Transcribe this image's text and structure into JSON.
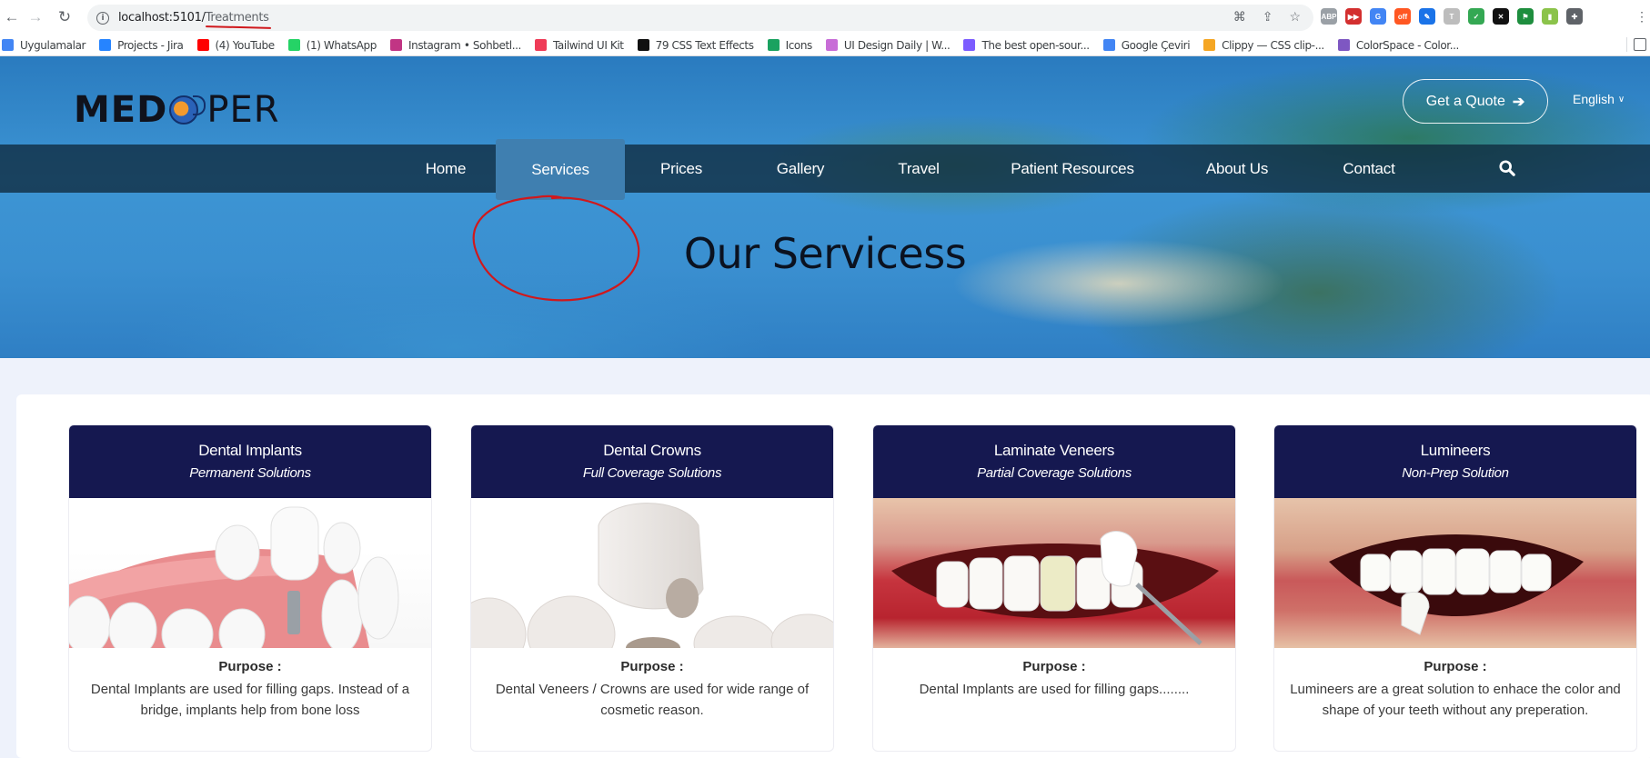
{
  "browser": {
    "url_host": "localhost:5101/",
    "url_path": "Treatments",
    "bookmarks": [
      {
        "label": "Uygulamalar",
        "icon": "apps-grid-icon",
        "color": "#4285f4"
      },
      {
        "label": "Projects - Jira",
        "icon": "jira-icon",
        "color": "#2684ff"
      },
      {
        "label": "(4) YouTube",
        "icon": "youtube-icon",
        "color": "#ff0000"
      },
      {
        "label": "(1) WhatsApp",
        "icon": "whatsapp-icon",
        "color": "#25d366"
      },
      {
        "label": "Instagram • Sohbetl...",
        "icon": "instagram-icon",
        "color": "#c13584"
      },
      {
        "label": "Tailwind UI Kit",
        "icon": "tailwind-icon",
        "color": "#ef3b57"
      },
      {
        "label": "79 CSS Text Effects",
        "icon": "css-effects-icon",
        "color": "#111111"
      },
      {
        "label": "Icons",
        "icon": "icons-site-icon",
        "color": "#1aa260"
      },
      {
        "label": "UI Design Daily | W...",
        "icon": "ui-design-daily-icon",
        "color": "#c86dd7"
      },
      {
        "label": "The best open-sour...",
        "icon": "open-source-icon",
        "color": "#7c5cff"
      },
      {
        "label": "Google Çeviri",
        "icon": "google-translate-icon",
        "color": "#4285f4"
      },
      {
        "label": "Clippy — CSS clip-...",
        "icon": "clippy-icon",
        "color": "#f5a623"
      },
      {
        "label": "ColorSpace - Color...",
        "icon": "colorspace-icon",
        "color": "#7e57c2"
      }
    ],
    "extensions": [
      {
        "name": "adblock-plus-icon",
        "label": "ABP",
        "color": "#9aa0a6"
      },
      {
        "name": "fast-forward-icon",
        "label": "▶▶",
        "color": "#d32f2f"
      },
      {
        "name": "google-translate-ext-icon",
        "label": "G",
        "color": "#4285f4"
      },
      {
        "name": "off-badge-ext-icon",
        "label": "off",
        "color": "#ff5722"
      },
      {
        "name": "color-picker-icon",
        "label": "✎",
        "color": "#1a73e8"
      },
      {
        "name": "font-t-icon",
        "label": "T",
        "color": "#bdbdbd"
      },
      {
        "name": "brush-ext-icon",
        "label": "✓",
        "color": "#34a853"
      },
      {
        "name": "screen-capture-icon",
        "label": "✕",
        "color": "#111111"
      },
      {
        "name": "flag-ext-icon",
        "label": "⚑",
        "color": "#1e8e3e"
      },
      {
        "name": "tag-ext-icon",
        "label": "▮",
        "color": "#8bc34a"
      },
      {
        "name": "puzzle-extensions-icon",
        "label": "✚",
        "color": "#5f6368"
      }
    ]
  },
  "site": {
    "brand": {
      "part1": "MED",
      "part2": "PER"
    },
    "quote_button": "Get a Quote",
    "language": "English",
    "nav": [
      {
        "label": "Home"
      },
      {
        "label": "Services",
        "active": true
      },
      {
        "label": "Prices"
      },
      {
        "label": "Gallery"
      },
      {
        "label": "Travel"
      },
      {
        "label": "Patient Resources"
      },
      {
        "label": "About Us"
      },
      {
        "label": "Contact"
      }
    ],
    "page_title": "Our Servicess",
    "annotation_color": "#d0181c",
    "accent_color": "#151850"
  },
  "cards": [
    {
      "title": "Dental Implants",
      "subtitle": "Permanent Solutions",
      "purpose_label": "Purpose :",
      "description": "Dental Implants are used for filling gaps. Instead of a bridge, implants help from bone loss"
    },
    {
      "title": "Dental Crowns",
      "subtitle": "Full Coverage Solutions",
      "purpose_label": "Purpose :",
      "description": "Dental Veneers / Crowns are used for wide range of cosmetic reason."
    },
    {
      "title": "Laminate Veneers",
      "subtitle": "Partial Coverage Solutions",
      "purpose_label": "Purpose :",
      "description": "Dental Implants are used for filling gaps........"
    },
    {
      "title": "Lumineers",
      "subtitle": "Non-Prep Solution",
      "purpose_label": "Purpose :",
      "description": "Lumineers are a great solution to enhace the color and shape of your teeth without any preperation."
    }
  ]
}
